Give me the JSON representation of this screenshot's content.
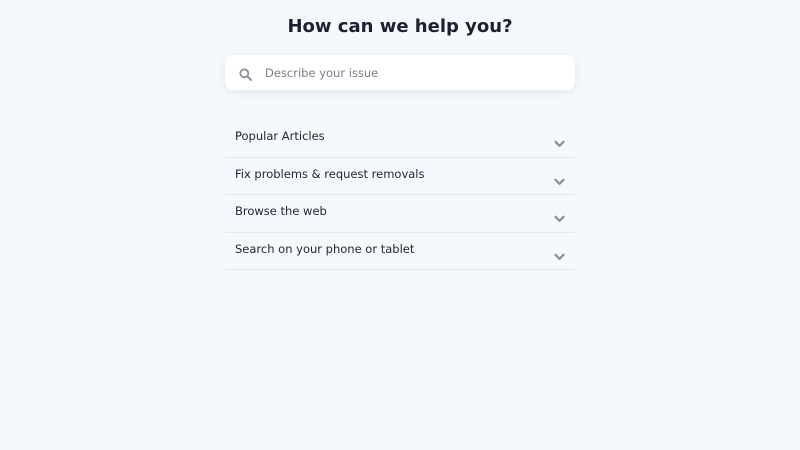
{
  "page": {
    "title": "How can we help you?"
  },
  "search": {
    "placeholder": "Describe your issue",
    "value": "",
    "icon": "search-icon"
  },
  "faq": {
    "items": [
      {
        "label": "Popular Articles",
        "icon": "chevron-down-icon"
      },
      {
        "label": "Fix problems & request removals",
        "icon": "chevron-down-icon"
      },
      {
        "label": "Browse the web",
        "icon": "chevron-down-icon"
      },
      {
        "label": "Search on your phone or tablet",
        "icon": "chevron-down-icon"
      }
    ]
  },
  "colors": {
    "background": "#f5f8fc",
    "card": "#ffffff",
    "text": "#1f2533",
    "muted_icon": "#8a8f99",
    "divider": "#e3e7ee"
  }
}
